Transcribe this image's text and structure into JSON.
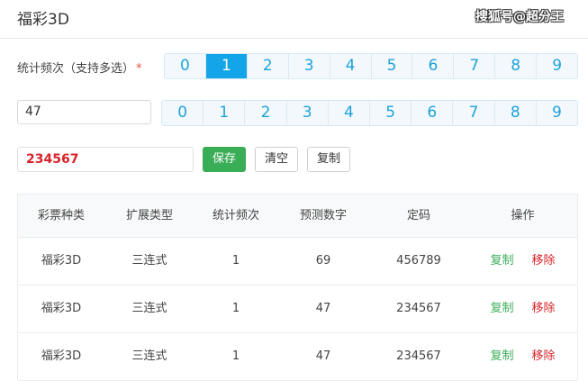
{
  "header": {
    "title": "福彩3D",
    "watermark": "搜狐号@超分王"
  },
  "frequency": {
    "label": "统计频次（支持多选）",
    "required_mark": "*",
    "digits": [
      "0",
      "1",
      "2",
      "3",
      "4",
      "5",
      "6",
      "7",
      "8",
      "9"
    ],
    "selected": "1"
  },
  "number_input": {
    "value": "47"
  },
  "digit_pad": {
    "digits": [
      "0",
      "1",
      "2",
      "3",
      "4",
      "5",
      "6",
      "7",
      "8",
      "9"
    ]
  },
  "result": {
    "value": "234567"
  },
  "actions": {
    "save": "保存",
    "clear": "清空",
    "copy": "复制"
  },
  "table": {
    "headers": [
      "彩票种类",
      "扩展类型",
      "统计频次",
      "预测数字",
      "定码",
      "操作"
    ],
    "rows": [
      {
        "type": "福彩3D",
        "ext": "三连式",
        "freq": "1",
        "predict": "69",
        "fixed": "456789",
        "copy": "复制",
        "remove": "移除"
      },
      {
        "type": "福彩3D",
        "ext": "三连式",
        "freq": "1",
        "predict": "47",
        "fixed": "234567",
        "copy": "复制",
        "remove": "移除"
      },
      {
        "type": "福彩3D",
        "ext": "三连式",
        "freq": "1",
        "predict": "47",
        "fixed": "234567",
        "copy": "复制",
        "remove": "移除"
      }
    ]
  },
  "colors": {
    "accent": "#14a5e8",
    "save_green": "#3aad57",
    "danger_red": "#d9232b"
  }
}
